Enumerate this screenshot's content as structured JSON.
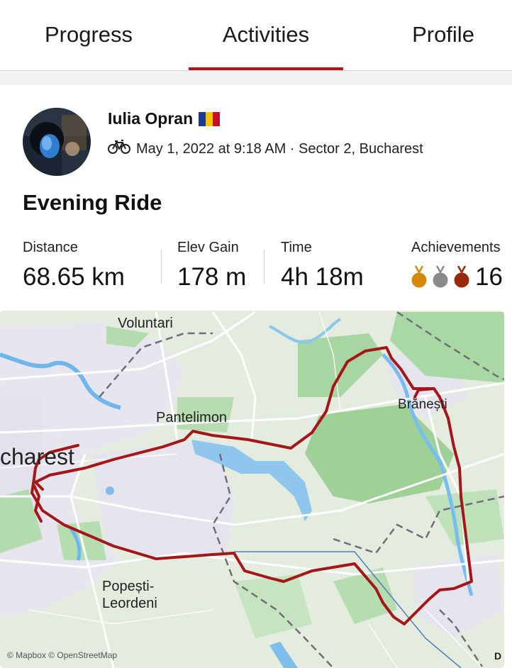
{
  "tabs": [
    {
      "label": "Progress"
    },
    {
      "label": "Activities"
    },
    {
      "label": "Profile"
    }
  ],
  "active_tab": "Activities",
  "activity": {
    "athlete_name": "Iulia Opran",
    "athlete_flag": "romania-flag-icon",
    "sport_icon": "bicycle-icon",
    "date_location": "May 1, 2022 at 9:18 AM · Sector 2, Bucharest",
    "title": "Evening Ride"
  },
  "stats": {
    "distance_label": "Distance",
    "distance_value": "68.65 km",
    "elev_label": "Elev Gain",
    "elev_value": "178 m",
    "time_label": "Time",
    "time_value": "4h 18m",
    "achievements_label": "Achievements",
    "achievements_count": "16",
    "medal_icons": [
      "gold-medal-icon",
      "silver-medal-icon",
      "bronze-medal-icon"
    ]
  },
  "map": {
    "labels": {
      "voluntari": "Voluntari",
      "pantelimon": "Pantelimon",
      "branesti": "Brănești",
      "bucharest": "charest",
      "popesti_line1": "Popești-",
      "popesti_line2": "Leordeni"
    },
    "attribution": "© Mapbox © OpenStreetMap",
    "corner_letter": "D"
  },
  "colors": {
    "accent": "#b0151b",
    "route": "#a51618",
    "gold": "#d4890a",
    "silver": "#8a8a8a",
    "bronze": "#9a2a0c"
  }
}
